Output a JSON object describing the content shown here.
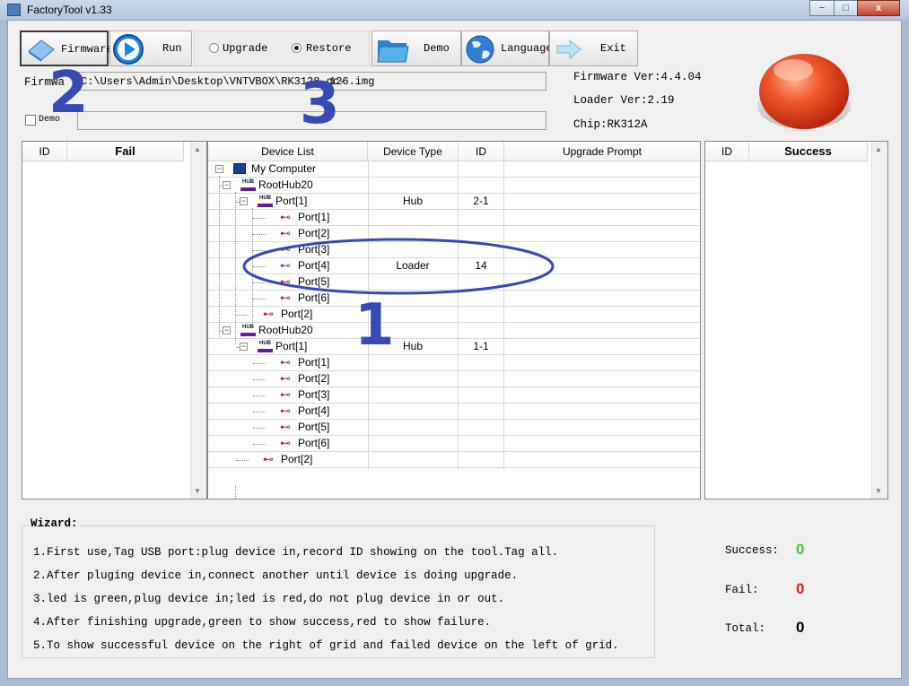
{
  "window": {
    "title": "FactoryTool v1.33",
    "minimize": "−",
    "maximize": "□",
    "close": "x"
  },
  "toolbar": {
    "firmware": "Firmware",
    "run": "Run",
    "upgrade": "Upgrade",
    "restore": "Restore",
    "demo": "Demo",
    "language": "Language",
    "exit": "Exit"
  },
  "firmware_row": {
    "label": "Firmwa",
    "path": "C:\\Users\\Admin\\Desktop\\VNTVBOX\\RK3128-gc-",
    "path_tail": "126.img"
  },
  "demo_checkbox": {
    "label": "Demo",
    "checked": false
  },
  "info": {
    "firmware_ver": "Firmware Ver:4.4.04",
    "loader_ver": "Loader Ver:2.19",
    "chip": "Chip:RK312A"
  },
  "fail_grid": {
    "headers": [
      "ID",
      "Fail"
    ]
  },
  "success_grid": {
    "headers": [
      "ID",
      "Success"
    ]
  },
  "device_grid": {
    "headers": [
      "Device List",
      "Device Type",
      "ID",
      "Upgrade Prompt"
    ],
    "rows": [
      {
        "label": "My Computer",
        "type": "",
        "id": ""
      },
      {
        "label": "RootHub20",
        "type": "",
        "id": ""
      },
      {
        "label": "Port[1]",
        "type": "Hub",
        "id": "2-1"
      },
      {
        "label": "Port[1]",
        "type": "",
        "id": ""
      },
      {
        "label": "Port[2]",
        "type": "",
        "id": ""
      },
      {
        "label": "Port[3]",
        "type": "",
        "id": ""
      },
      {
        "label": "Port[4]",
        "type": "Loader",
        "id": "14"
      },
      {
        "label": "Port[5]",
        "type": "",
        "id": ""
      },
      {
        "label": "Port[6]",
        "type": "",
        "id": ""
      },
      {
        "label": "Port[2]",
        "type": "",
        "id": ""
      },
      {
        "label": "RootHub20",
        "type": "",
        "id": ""
      },
      {
        "label": "Port[1]",
        "type": "Hub",
        "id": "1-1"
      },
      {
        "label": "Port[1]",
        "type": "",
        "id": ""
      },
      {
        "label": "Port[2]",
        "type": "",
        "id": ""
      },
      {
        "label": "Port[3]",
        "type": "",
        "id": ""
      },
      {
        "label": "Port[4]",
        "type": "",
        "id": ""
      },
      {
        "label": "Port[5]",
        "type": "",
        "id": ""
      },
      {
        "label": "Port[6]",
        "type": "",
        "id": ""
      },
      {
        "label": "Port[2]",
        "type": "",
        "id": ""
      }
    ]
  },
  "wizard": {
    "title": "Wizard:",
    "lines": [
      "1.First use,Tag USB port:plug device in,record ID showing on the tool.Tag all.",
      "2.After pluging device in,connect another until device is doing upgrade.",
      "3.led is green,plug device in;led is red,do not plug device in or out.",
      "4.After finishing upgrade,green to show success,red to show failure.",
      "5.To show successful device on the right of grid and failed device on the left of grid."
    ]
  },
  "stats": {
    "success_label": "Success:",
    "success_value": "0",
    "fail_label": "Fail:",
    "fail_value": "0",
    "total_label": "Total:",
    "total_value": "0"
  },
  "annotations": {
    "n1": "1",
    "n2": "2",
    "n3": "3"
  },
  "colors": {
    "success": "#3ec43e",
    "fail": "#e02020",
    "annotation": "#3848b7",
    "led": "#e8431c"
  }
}
